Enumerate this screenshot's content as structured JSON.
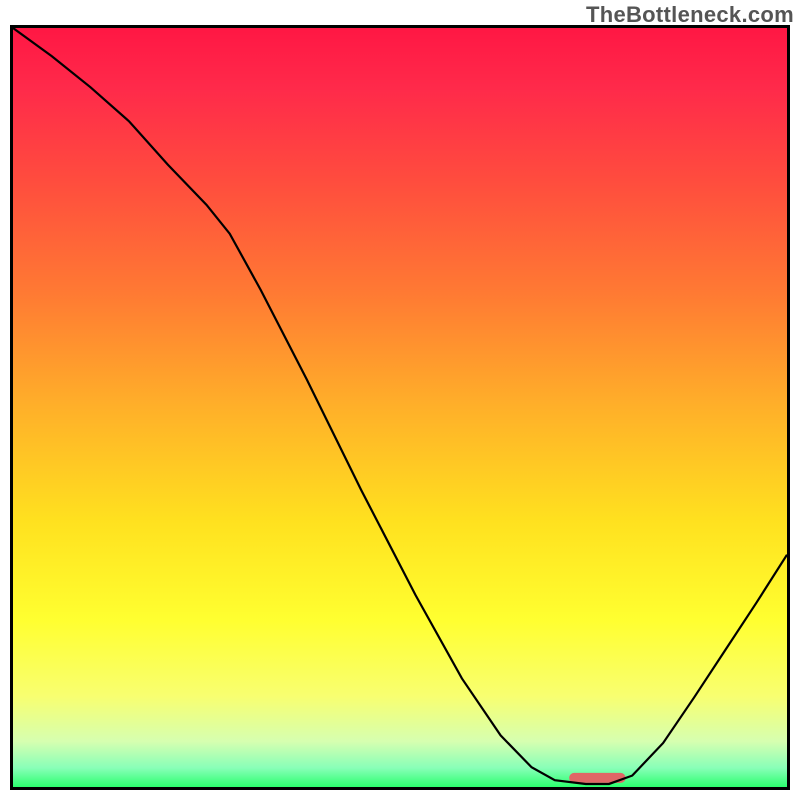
{
  "watermark": "TheBottleneck.com",
  "chart_data": {
    "type": "line",
    "title": "",
    "xlabel": "",
    "ylabel": "",
    "xlim": [
      0,
      100
    ],
    "ylim": [
      0,
      100
    ],
    "gradient_stops": [
      {
        "offset": 0.0,
        "color": "#ff1744"
      },
      {
        "offset": 0.08,
        "color": "#ff2a4a"
      },
      {
        "offset": 0.2,
        "color": "#ff4c3e"
      },
      {
        "offset": 0.35,
        "color": "#ff7a33"
      },
      {
        "offset": 0.5,
        "color": "#ffb029"
      },
      {
        "offset": 0.65,
        "color": "#ffe11f"
      },
      {
        "offset": 0.78,
        "color": "#ffff30"
      },
      {
        "offset": 0.88,
        "color": "#f8ff70"
      },
      {
        "offset": 0.94,
        "color": "#d6ffb0"
      },
      {
        "offset": 0.975,
        "color": "#88ffb8"
      },
      {
        "offset": 1.0,
        "color": "#2cff6e"
      }
    ],
    "curve": [
      {
        "x": 0.0,
        "y": 100.0
      },
      {
        "x": 5.0,
        "y": 96.3
      },
      {
        "x": 10.0,
        "y": 92.2
      },
      {
        "x": 15.0,
        "y": 87.7
      },
      {
        "x": 20.0,
        "y": 82.0
      },
      {
        "x": 25.0,
        "y": 76.7
      },
      {
        "x": 28.0,
        "y": 72.9
      },
      {
        "x": 32.0,
        "y": 65.5
      },
      {
        "x": 38.0,
        "y": 53.6
      },
      {
        "x": 45.0,
        "y": 39.1
      },
      {
        "x": 52.0,
        "y": 25.3
      },
      {
        "x": 58.0,
        "y": 14.3
      },
      {
        "x": 63.0,
        "y": 6.8
      },
      {
        "x": 67.0,
        "y": 2.6
      },
      {
        "x": 70.0,
        "y": 0.9
      },
      {
        "x": 74.0,
        "y": 0.4
      },
      {
        "x": 77.0,
        "y": 0.4
      },
      {
        "x": 80.0,
        "y": 1.5
      },
      {
        "x": 84.0,
        "y": 5.8
      },
      {
        "x": 88.0,
        "y": 11.8
      },
      {
        "x": 92.0,
        "y": 18.0
      },
      {
        "x": 96.0,
        "y": 24.2
      },
      {
        "x": 100.0,
        "y": 30.6
      }
    ],
    "marker": {
      "x_center": 75.5,
      "x_halfwidth": 3.0,
      "y": 1.2,
      "color": "#e06666",
      "stroke_width": 10
    }
  }
}
